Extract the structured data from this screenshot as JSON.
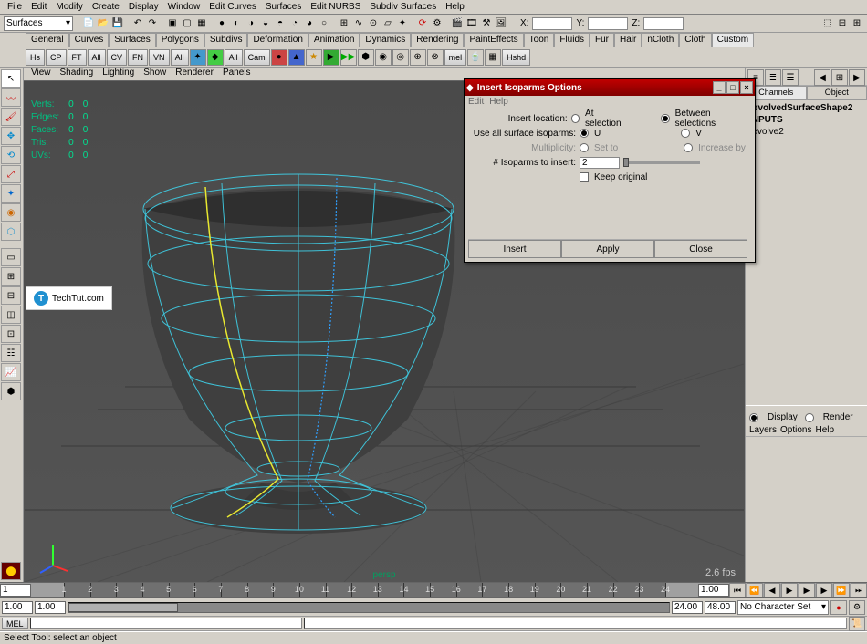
{
  "menubar": [
    "File",
    "Edit",
    "Modify",
    "Create",
    "Display",
    "Window",
    "Edit Curves",
    "Surfaces",
    "Edit NURBS",
    "Subdiv Surfaces",
    "Help"
  ],
  "module_dropdown": "Surfaces",
  "coord_labels": {
    "x": "X:",
    "y": "Y:",
    "z": "Z:"
  },
  "shelf_tabs": [
    "General",
    "Curves",
    "Surfaces",
    "Polygons",
    "Subdivs",
    "Deformation",
    "Animation",
    "Dynamics",
    "Rendering",
    "PaintEffects",
    "Toon",
    "Fluids",
    "Fur",
    "Hair",
    "nCloth",
    "Cloth",
    "Custom"
  ],
  "shelf_active_tab": "Custom",
  "sec_btns": [
    "Hs",
    "CP",
    "FT",
    "All",
    "CV",
    "FN",
    "VN",
    "All",
    "All",
    "Cam"
  ],
  "sec_end": [
    "mel",
    "Hshd"
  ],
  "vp_menu": [
    "View",
    "Shading",
    "Lighting",
    "Show",
    "Renderer",
    "Panels"
  ],
  "stats_rows": [
    {
      "label": "Verts:",
      "a": "0",
      "b": "0"
    },
    {
      "label": "Edges:",
      "a": "0",
      "b": "0"
    },
    {
      "label": "Faces:",
      "a": "0",
      "b": "0"
    },
    {
      "label": "Tris:",
      "a": "0",
      "b": "0"
    },
    {
      "label": "UVs:",
      "a": "0",
      "b": "0"
    }
  ],
  "camera_label": "persp",
  "fps": "2.6 fps",
  "right_panel": {
    "tabs": [
      "Channels",
      "Object"
    ],
    "active_tab": "Channels",
    "nodes": [
      "revolvedSurfaceShape2",
      "INPUTS",
      "  revolve2"
    ],
    "radios": [
      "Display",
      "Render"
    ],
    "lower_menu": [
      "Layers",
      "Options",
      "Help"
    ]
  },
  "dialog": {
    "title": "Insert Isoparms Options",
    "menu": [
      "Edit",
      "Help"
    ],
    "rows": {
      "insert_location": {
        "label": "Insert location:",
        "opt1": "At selection",
        "opt2": "Between selections",
        "selected": "opt2"
      },
      "use_all": {
        "label": "Use all surface isoparms:",
        "opt1": "U",
        "opt2": "V",
        "selected": "opt1"
      },
      "multiplicity": {
        "label": "Multiplicity:",
        "opt1": "Set to",
        "opt2": "Increase by"
      },
      "num_insert": {
        "label": "# Isoparms to insert:",
        "value": "2"
      },
      "keep_original": {
        "label": "Keep original"
      }
    },
    "buttons": [
      "Insert",
      "Apply",
      "Close"
    ]
  },
  "timeline": {
    "start": "1",
    "visible_start": "1.00",
    "ticks": [
      "1",
      "2",
      "3",
      "4",
      "5",
      "6",
      "7",
      "8",
      "9",
      "10",
      "11",
      "12",
      "13",
      "14",
      "15",
      "16",
      "17",
      "18",
      "19",
      "20",
      "21",
      "22",
      "23",
      "24"
    ],
    "range_start": "1.00",
    "range_end": "24.00",
    "end": "48.00",
    "char_set": "No Character Set"
  },
  "cmd": {
    "label": "MEL"
  },
  "status": "Select Tool: select an object",
  "watermark": "TechTut.com"
}
